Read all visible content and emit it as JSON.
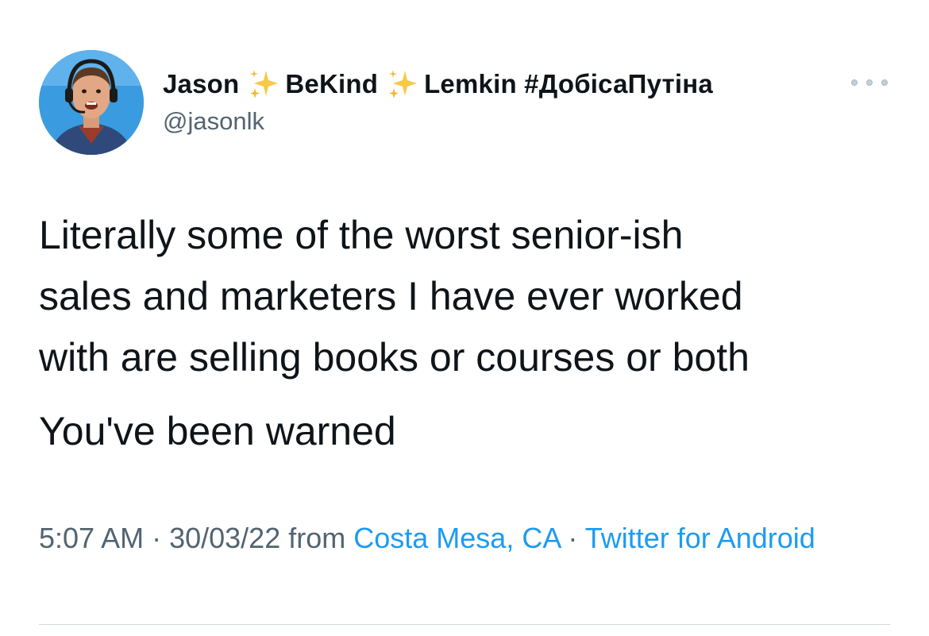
{
  "author": {
    "name_part1": "Jason",
    "name_part2": "BeKind",
    "name_part3": "Lemkin #ДобісаПутіна",
    "emoji": "sparkles",
    "handle": "@jasonlk",
    "avatar_icon": "profile-photo"
  },
  "menu": {
    "icon": "more-options-icon"
  },
  "tweet": {
    "lines": [
      "Literally some of the worst senior-ish",
      "sales and marketers I have ever worked",
      "with are selling books or courses or both"
    ],
    "second_paragraph": "You've been warned"
  },
  "meta": {
    "time": "5:07 AM",
    "separator": " · ",
    "date": "30/03/22",
    "from_text": " from ",
    "location": "Costa Mesa, CA",
    "separator2": " · ",
    "source": "Twitter for Android"
  },
  "colors": {
    "text": "#0f1419",
    "secondary": "#536471",
    "link": "#1d9bf0",
    "avatar_bg": "#3d9ee0"
  }
}
